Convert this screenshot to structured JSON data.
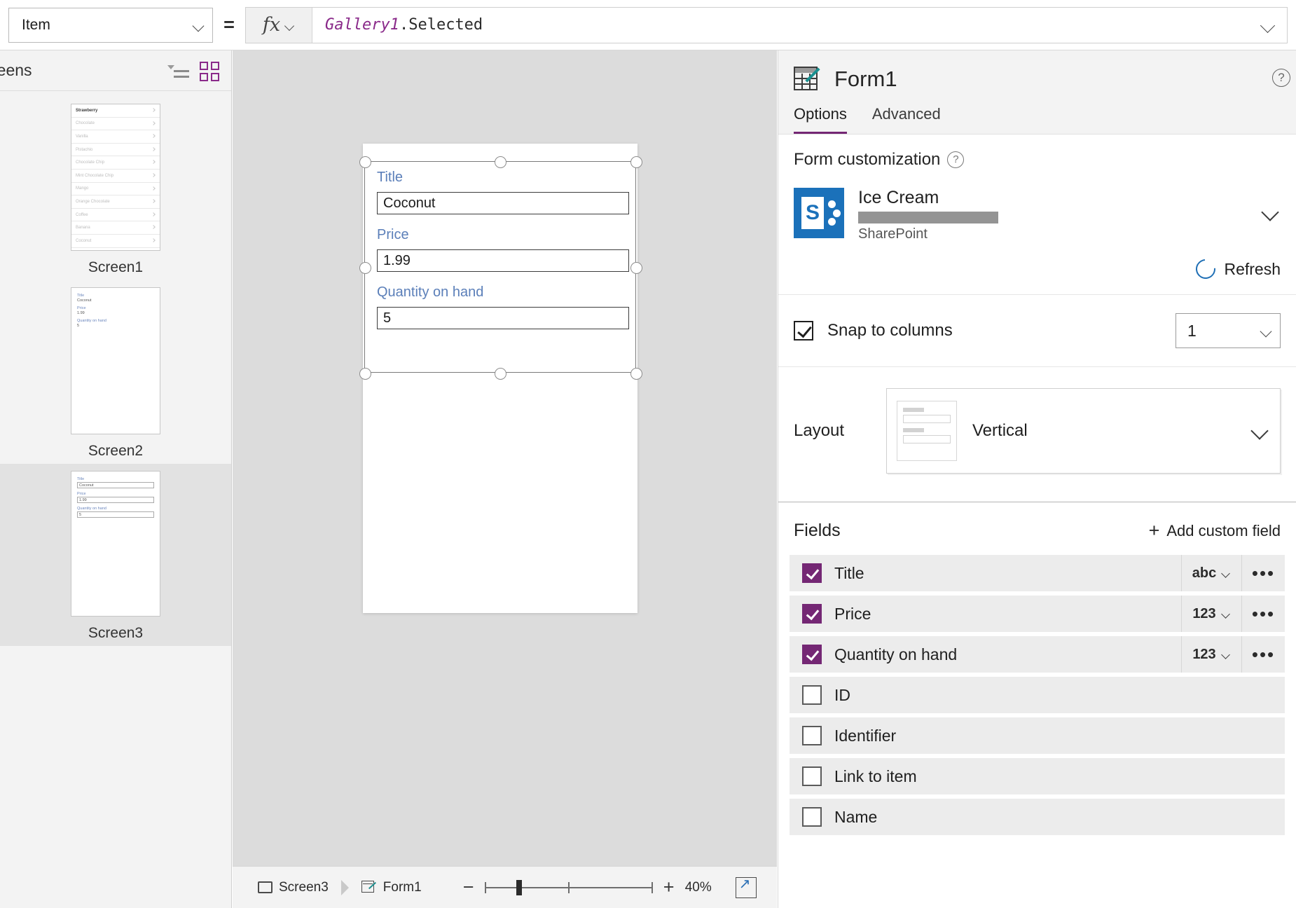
{
  "formula_bar": {
    "property": "Item",
    "equals": "=",
    "fx_label": "fx",
    "formula_object": "Gallery1",
    "formula_rest": ".Selected"
  },
  "left_panel": {
    "title": "reens",
    "tree_view_icon": "tree-view-icon",
    "grid_view_icon": "grid-view-icon",
    "screens": [
      {
        "label": "Screen1",
        "selected": false,
        "gallery_items": [
          "Strawberry",
          "Chocolate",
          "Vanilla",
          "Pistachio",
          "Chocolate Chip",
          "Mint Chocolate Chip",
          "Mango",
          "Orange Chocolate",
          "Coffee",
          "Banana",
          "Coconut"
        ]
      },
      {
        "label": "Screen2",
        "selected": false,
        "form_preview": [
          {
            "label": "Title",
            "value": "Coconut"
          },
          {
            "label": "Price",
            "value": "1.99"
          },
          {
            "label": "Quantity on hand",
            "value": "5"
          }
        ]
      },
      {
        "label": "Screen3",
        "selected": true,
        "form_preview": [
          {
            "label": "Title",
            "value": "Coconut"
          },
          {
            "label": "Price",
            "value": "1.99"
          },
          {
            "label": "Quantity on hand",
            "value": "5"
          }
        ]
      }
    ]
  },
  "canvas": {
    "form_fields": [
      {
        "label": "Title",
        "value": "Coconut"
      },
      {
        "label": "Price",
        "value": "1.99"
      },
      {
        "label": "Quantity on hand",
        "value": "5"
      }
    ]
  },
  "bottom_bar": {
    "breadcrumb": [
      {
        "label": "Screen3",
        "icon": "screen-icon"
      },
      {
        "label": "Form1",
        "icon": "form-icon"
      }
    ],
    "zoom_out": "−",
    "zoom_in": "+",
    "zoom_level": "40%",
    "fit_label": "fit-to-screen-icon"
  },
  "right_panel": {
    "title": "Form1",
    "help_icon": "?",
    "tabs": [
      {
        "label": "Options",
        "active": true
      },
      {
        "label": "Advanced",
        "active": false
      }
    ],
    "form_customization": {
      "heading": "Form customization",
      "help_icon": "?",
      "data_source": {
        "name": "Ice Cream",
        "redacted": "",
        "type": "SharePoint",
        "logo": "sharepoint-logo",
        "logo_letter": "S"
      },
      "refresh_label": "Refresh"
    },
    "snap": {
      "label": "Snap to columns",
      "checked": true,
      "columns": "1"
    },
    "layout": {
      "label": "Layout",
      "value": "Vertical"
    },
    "fields": {
      "title": "Fields",
      "add_label": "Add custom field",
      "rows": [
        {
          "name": "Title",
          "checked": true,
          "type": "abc",
          "more": "•••"
        },
        {
          "name": "Price",
          "checked": true,
          "type": "123",
          "more": "•••"
        },
        {
          "name": "Quantity on hand",
          "checked": true,
          "type": "123",
          "more": "•••"
        },
        {
          "name": "ID",
          "checked": false,
          "type": "",
          "more": ""
        },
        {
          "name": "Identifier",
          "checked": false,
          "type": "",
          "more": ""
        },
        {
          "name": "Link to item",
          "checked": false,
          "type": "",
          "more": ""
        },
        {
          "name": "Name",
          "checked": false,
          "type": "",
          "more": ""
        }
      ]
    }
  },
  "colors": {
    "accent_purple": "#742774",
    "label_blue": "#5b7fb9",
    "sharepoint_blue": "#1b71ba",
    "teal": "#1a9090"
  }
}
